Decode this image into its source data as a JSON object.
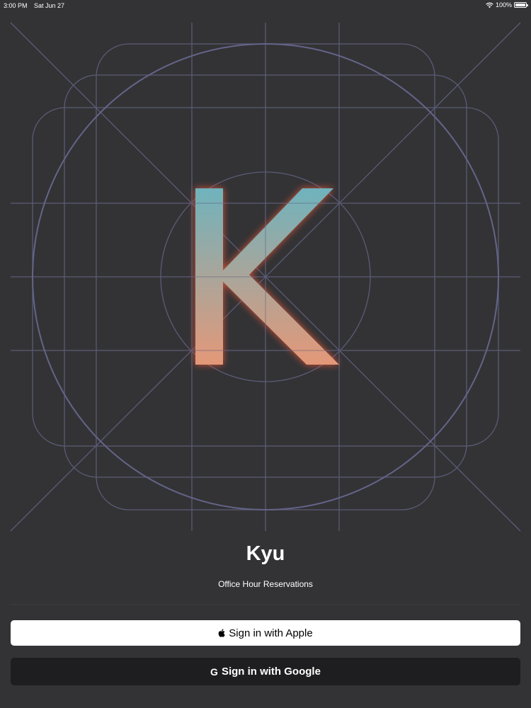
{
  "status_bar": {
    "time": "3:00 PM",
    "date": "Sat Jun 27",
    "battery": "100%",
    "battery_level": 1.0
  },
  "logo": {
    "letter": "K",
    "gradient_top": "#6fb3bd",
    "gradient_bottom": "#e49878",
    "glow_color": "#e0563a",
    "grid_color": "#5b5b78"
  },
  "app": {
    "title": "Kyu",
    "subtitle": "Office Hour Reservations"
  },
  "buttons": {
    "apple_label": "Sign in with Apple",
    "apple_icon": "apple-icon",
    "google_label": "Sign in with Google",
    "google_icon": "google-g-icon",
    "google_glyph": "G"
  }
}
